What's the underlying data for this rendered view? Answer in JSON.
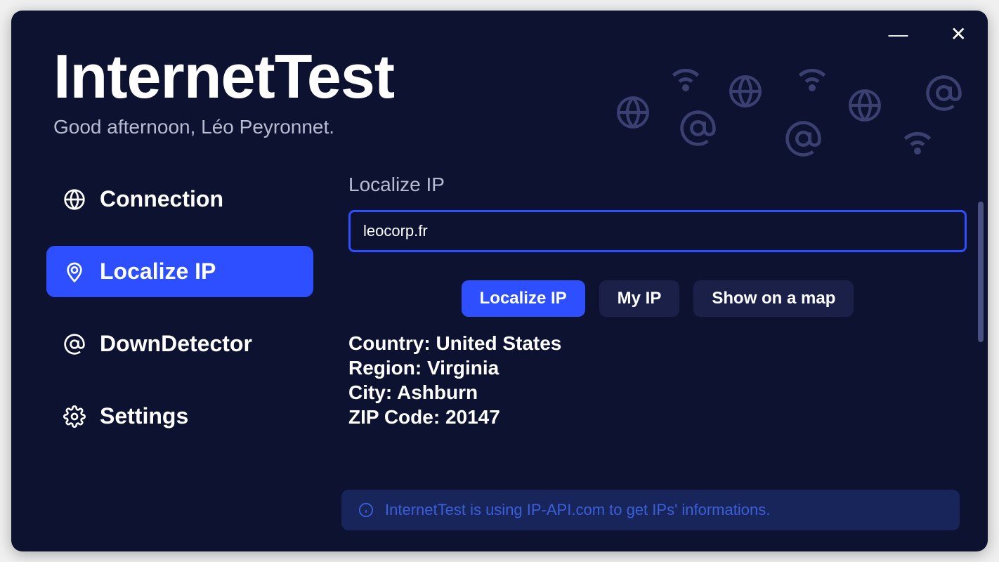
{
  "app": {
    "title": "InternetTest",
    "greeting": "Good afternoon, Léo Peyronnet."
  },
  "sidebar": {
    "items": [
      {
        "label": "Connection",
        "icon": "globe-icon",
        "active": false
      },
      {
        "label": "Localize IP",
        "icon": "pin-icon",
        "active": true
      },
      {
        "label": "DownDetector",
        "icon": "at-icon",
        "active": false
      },
      {
        "label": "Settings",
        "icon": "gear-icon",
        "active": false
      }
    ]
  },
  "main": {
    "section_title": "Localize IP",
    "input_value": "leocorp.fr",
    "buttons": {
      "localize": "Localize IP",
      "myip": "My IP",
      "showmap": "Show on a map"
    },
    "results": [
      {
        "label": "Country",
        "value": "United States"
      },
      {
        "label": "Region",
        "value": "Virginia"
      },
      {
        "label": "City",
        "value": "Ashburn"
      },
      {
        "label": "ZIP Code",
        "value": "20147"
      }
    ]
  },
  "info_banner": {
    "text": "InternetTest is using IP-API.com to get IPs' informations."
  },
  "colors": {
    "accent": "#2d4fff",
    "bg": "#0d1230",
    "text_muted": "#b8bcd0"
  }
}
